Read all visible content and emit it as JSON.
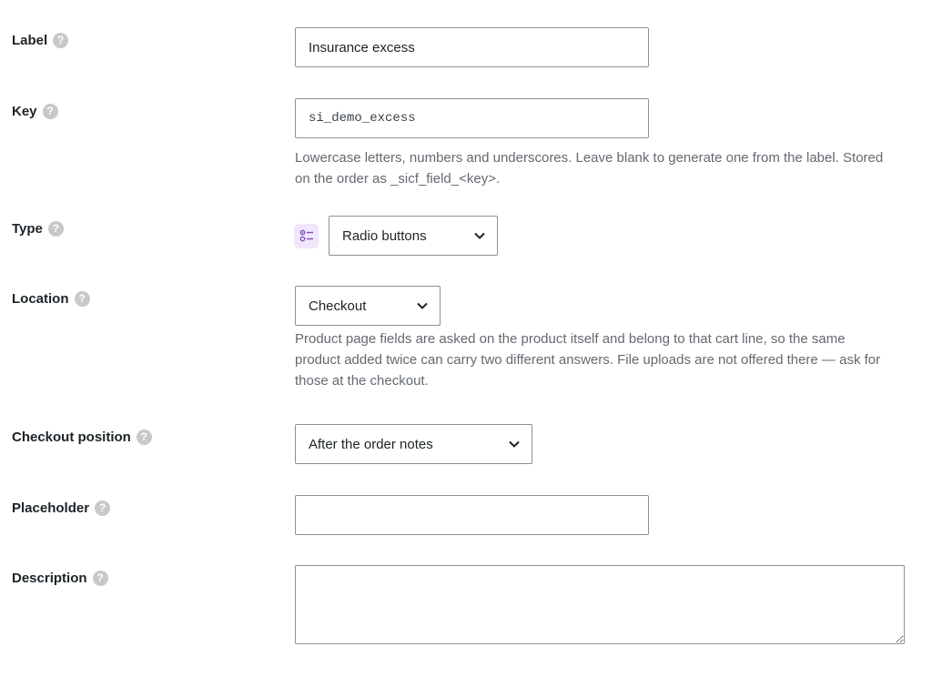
{
  "fields": {
    "label": {
      "title": "Label",
      "help": "?",
      "value": "Insurance excess"
    },
    "key": {
      "title": "Key",
      "help": "?",
      "value": "si_demo_excess",
      "help_line1": "Lowercase letters, numbers and underscores. Leave blank to generate one from the label. Stored",
      "help_line2": "on the order as _sicf_field_<key>."
    },
    "type": {
      "title": "Type",
      "help": "?",
      "icon": "radio-list-icon",
      "selected": "Radio buttons"
    },
    "location": {
      "title": "Location",
      "help": "?",
      "selected": "Checkout",
      "help_line1": "Product page fields are asked on the product itself and belong to that cart line, so the same",
      "help_line2": "product added twice can carry two different answers. File uploads are not offered there — ask for",
      "help_line3": "those at the checkout."
    },
    "checkout_position": {
      "title": "Checkout position",
      "help": "?",
      "selected": "After the order notes"
    },
    "placeholder": {
      "title": "Placeholder",
      "help": "?",
      "value": ""
    },
    "description": {
      "title": "Description",
      "help": "?",
      "value": ""
    }
  },
  "colors": {
    "accent_icon_bg": "#efe7fb",
    "accent_icon": "#7f54b3",
    "help_icon_bg": "#c8c8c8",
    "help_text": "#646970",
    "border": "#8c8f94"
  }
}
